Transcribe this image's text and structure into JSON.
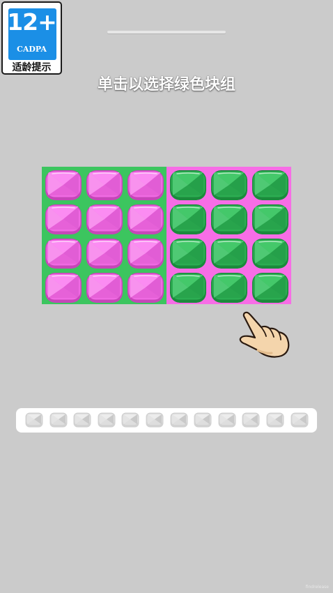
{
  "age_badge": {
    "age": "12+",
    "org": "CADPA",
    "tip": "适龄提示"
  },
  "level_progress": 0,
  "instruction": "单击以选择绿色块组",
  "board": {
    "rows": 4,
    "cols": 6,
    "left_group": {
      "background": "#3cc55f",
      "tile_color": "pink"
    },
    "right_group": {
      "background": "#f76de6",
      "tile_color": "green"
    }
  },
  "tray": {
    "slot_count": 12,
    "filled": 0
  },
  "watermark": "findrelease",
  "colors": {
    "pink_top": "#fb8cf2",
    "pink_mid": "#f06ae3",
    "pink_dark": "#c646b9",
    "green_top": "#44c86a",
    "green_mid": "#2cad52",
    "green_dark": "#1b8a3c",
    "background": "#cbcbcb"
  },
  "icons": {
    "hand": "pointing-hand-icon",
    "slot": "empty-slot-icon"
  }
}
